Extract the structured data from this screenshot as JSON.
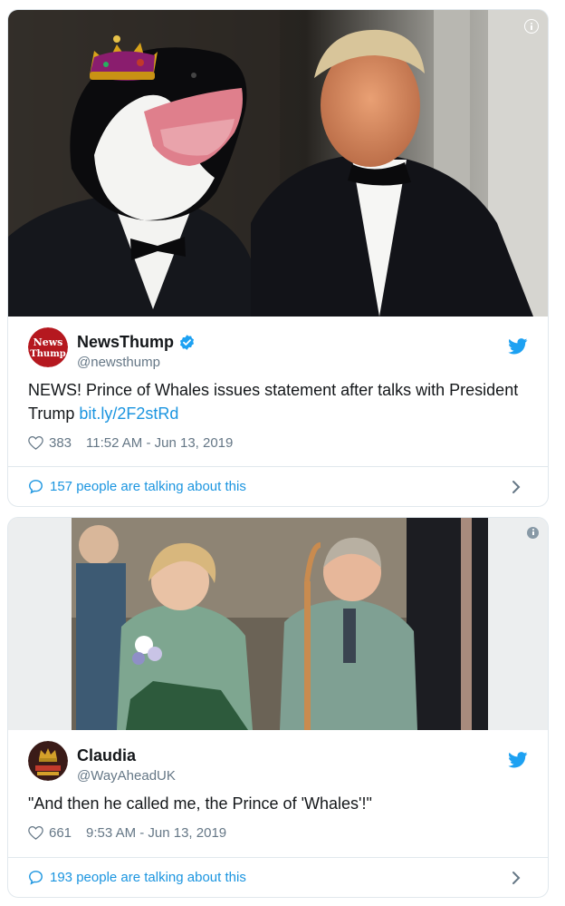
{
  "tweets": [
    {
      "name": "NewsThump",
      "verified": true,
      "handle": "@newsthump",
      "avatar_text_top": "News",
      "avatar_text_bottom": "Thump",
      "text": "NEWS! Prince of Whales issues statement after talks with President Trump ",
      "link": "bit.ly/2F2stRd",
      "likes": "383",
      "timestamp": "11:52 AM - Jun 13, 2019",
      "talking": "157 people are talking about this",
      "media_description": "Photo: orca whale head wearing crown in tuxedo beside man in tuxedo"
    },
    {
      "name": "Claudia",
      "verified": false,
      "handle": "@WayAheadUK",
      "text": "\"And then he called me, the Prince of 'Whales'!\"",
      "likes": "661",
      "timestamp": "9:53 AM - Jun 13, 2019",
      "talking": "193 people are talking about this",
      "media_description": "Photo: couple in green tweed laughing at outdoor event"
    }
  ],
  "colors": {
    "link": "#1b95e0",
    "secondary_text": "#657786",
    "border": "#e1e8ed",
    "avatar_red": "#b5181f"
  },
  "icons": [
    "info-icon",
    "verified-badge-icon",
    "twitter-bird-icon",
    "heart-icon",
    "speech-bubble-icon",
    "chevron-right-icon"
  ]
}
